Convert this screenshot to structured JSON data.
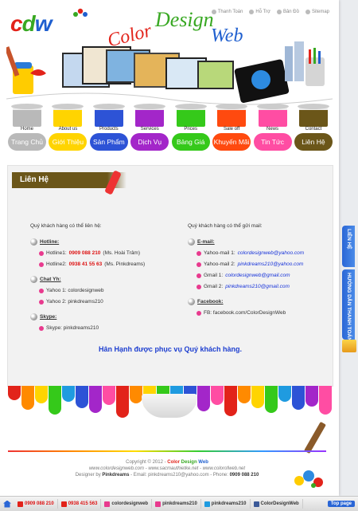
{
  "header": {
    "logo_text": "cdw",
    "brand_words": [
      "Color",
      "Design",
      "Web"
    ],
    "top_links": [
      {
        "label": "Thanh Toán",
        "icon": "cart-icon"
      },
      {
        "label": "Hỗ Trợ",
        "icon": "support-icon"
      },
      {
        "label": "Bản Đồ",
        "icon": "map-icon"
      },
      {
        "label": "Sitemap",
        "icon": "sitemap-icon"
      }
    ]
  },
  "menu": [
    {
      "top": "Home",
      "label": "Trang Chủ",
      "color": "#b9b9b9"
    },
    {
      "top": "About us",
      "label": "Giới Thiệu",
      "color": "#ffd400"
    },
    {
      "top": "Products",
      "label": "Sản Phẩm",
      "color": "#2d53d6"
    },
    {
      "top": "Services",
      "label": "Dịch Vụ",
      "color": "#a326c9"
    },
    {
      "top": "Prices",
      "label": "Bảng Giá",
      "color": "#35c91a"
    },
    {
      "top": "Sale off",
      "label": "Khuyến Mãi",
      "color": "#ff4a0f"
    },
    {
      "top": "News",
      "label": "Tin Tức",
      "color": "#ff4da3"
    },
    {
      "top": "Contact",
      "label": "Liên Hệ",
      "color": "#6b5619"
    }
  ],
  "content": {
    "title": "Liên Hệ",
    "left": {
      "intro": "Quý khách hàng có thể liên hệ:",
      "hotline": {
        "title": "Hotline:",
        "items": [
          {
            "prefix": "Hotline1:",
            "number": "0909 088 210",
            "suffix": "(Ms. Hoài Trâm)"
          },
          {
            "prefix": "Hotline2:",
            "number": "0938 41 55 63",
            "suffix": "(Ms. Pinkdreams)"
          }
        ]
      },
      "chat": {
        "title": "Chat Yh:",
        "items": [
          "Yahoo 1: colordesignweb",
          "Yahoo 2: pinkdreams210"
        ]
      },
      "skype": {
        "title": "Skype:",
        "items": [
          "Skype: pinkdreams210"
        ]
      }
    },
    "right": {
      "intro": "Quý khách hàng có thể gửi mail:",
      "email": {
        "title": "E-mail:",
        "items": [
          {
            "prefix": "Yahoo-mail 1:",
            "value": "colordesignweb@yahoo.com"
          },
          {
            "prefix": "Yahoo-mail 2:",
            "value": "pinkdreams210@yahoo.com"
          },
          {
            "prefix": "Gmail 1:",
            "value": "colordesignweb@gmail.com"
          },
          {
            "prefix": "Gmail 2:",
            "value": "pinkdreams210@gmail.com"
          }
        ]
      },
      "facebook": {
        "title": "Facebook:",
        "items": [
          "FB: facebook.com/ColorDesignWeb"
        ]
      }
    },
    "thanks": "Hân Hạnh được phục vụ Quý khách hàng."
  },
  "footer": {
    "copyright_prefix": "Copyright © 2012 -",
    "brand": [
      "Color",
      "Design",
      "Web"
    ],
    "sites": "www.colordesignweb.com - www.sacmauthietke.net - www.colorofweb.net",
    "designer_prefix": "Designer by",
    "designer_name": "Pinkdreams",
    "email_part": "- Email: pinkdreams210@yahoo.com - Phone:",
    "phone": "0909 088 210"
  },
  "side_tabs": [
    "LIÊN HỆ",
    "HƯỚNG DẪN THANH TOÁN"
  ],
  "bottom_bar": {
    "items": [
      {
        "label": "0909 088 210",
        "icon": "phone-icon",
        "color": "#e2231a"
      },
      {
        "label": "0938 415 563",
        "icon": "phone-icon",
        "color": "#e2231a"
      },
      {
        "label": "colordesignweb",
        "icon": "yahoo-icon",
        "color": "#e83a8e"
      },
      {
        "label": "pinkdreams210",
        "icon": "yahoo-icon",
        "color": "#e83a8e"
      },
      {
        "label": "pinkdreams210",
        "icon": "skype-icon",
        "color": "#1f9be0"
      },
      {
        "label": "ColorDesignWeb",
        "icon": "facebook-icon",
        "color": "#3b5998"
      }
    ],
    "top_button": "Top page"
  }
}
